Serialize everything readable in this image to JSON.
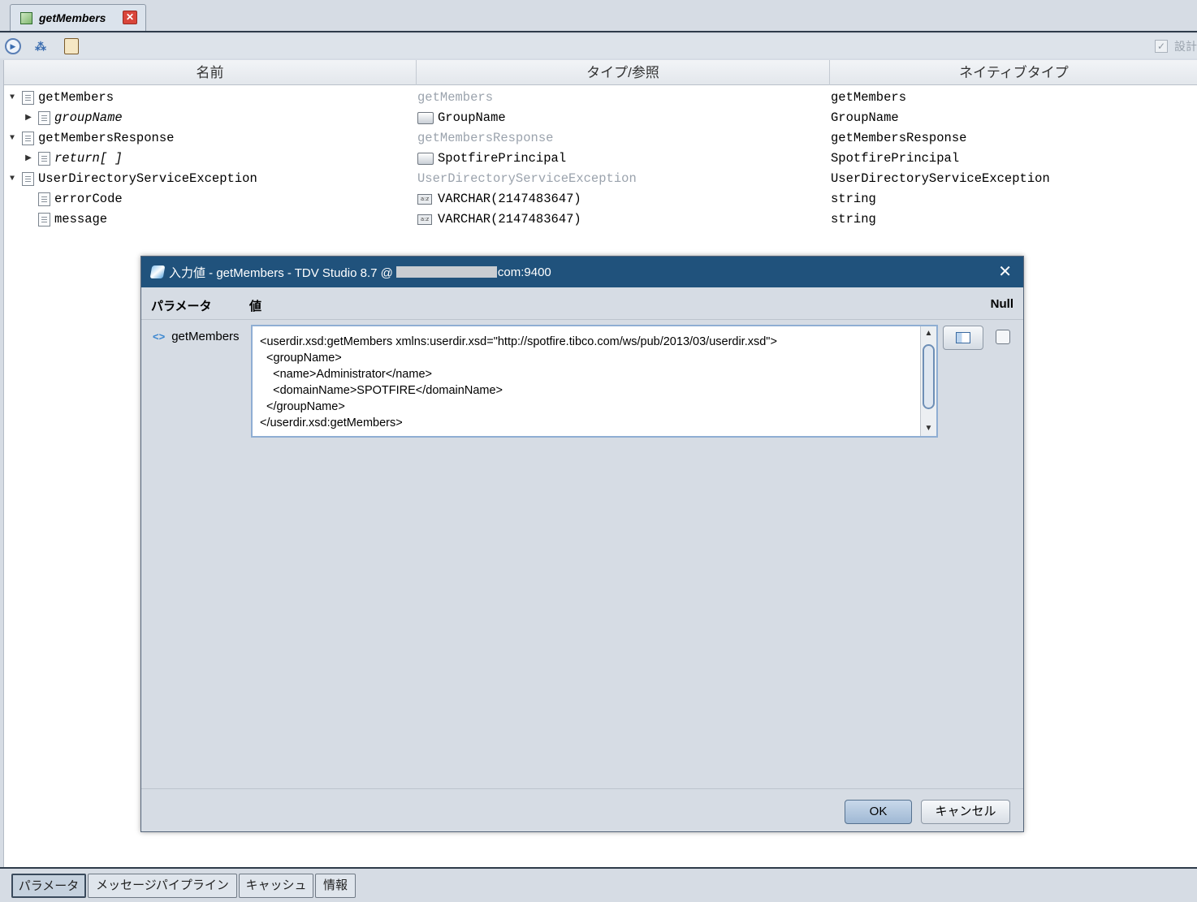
{
  "editor_tab": {
    "title": "getMembers",
    "close_label": "✕"
  },
  "toolbar": {
    "design_label": "設計",
    "design_check": "✓"
  },
  "columns": {
    "name": "名前",
    "type": "タイプ/参照",
    "native": "ネイティブタイプ"
  },
  "tree": [
    {
      "arrow": "▼",
      "name": "getMembers",
      "type": "getMembers",
      "native": "getMembers"
    },
    {
      "arrow": "▶",
      "name": "groupName",
      "type": "GroupName",
      "native": "GroupName"
    },
    {
      "arrow": "▼",
      "name": "getMembersResponse",
      "type": "getMembersResponse",
      "native": "getMembersResponse"
    },
    {
      "arrow": "▶",
      "name": "return[ ]",
      "type": "SpotfirePrincipal",
      "native": "SpotfirePrincipal"
    },
    {
      "arrow": "▼",
      "name": "UserDirectoryServiceException",
      "type": "UserDirectoryServiceException",
      "native": "UserDirectoryServiceException"
    },
    {
      "arrow": "",
      "name": "errorCode",
      "type": "VARCHAR(2147483647)",
      "native": "string"
    },
    {
      "arrow": "",
      "name": "message",
      "type": "VARCHAR(2147483647)",
      "native": "string"
    }
  ],
  "icons": {
    "varchar": "a:z"
  },
  "dialog": {
    "title_prefix": "入力値 - getMembers - TDV Studio 8.7 @",
    "title_suffix": "com:9400",
    "close": "✕",
    "header_param": "パラメータ",
    "header_value": "値",
    "header_null": "Null",
    "param_icon": "<>",
    "param_name": "getMembers",
    "xml_value": "<userdir.xsd:getMembers xmlns:userdir.xsd=\"http://spotfire.tibco.com/ws/pub/2013/03/userdir.xsd\">\n  <groupName>\n    <name>Administrator</name>\n    <domainName>SPOTFIRE</domainName>\n  </groupName>\n</userdir.xsd:getMembers>",
    "scroll_up": "▲",
    "scroll_down": "▼",
    "ok_label": "OK",
    "cancel_label": "キャンセル"
  },
  "bottom_tabs": [
    {
      "label": "パラメータ",
      "active": true
    },
    {
      "label": "メッセージパイプライン",
      "active": false
    },
    {
      "label": "キャッシュ",
      "active": false
    },
    {
      "label": "情報",
      "active": false
    }
  ]
}
